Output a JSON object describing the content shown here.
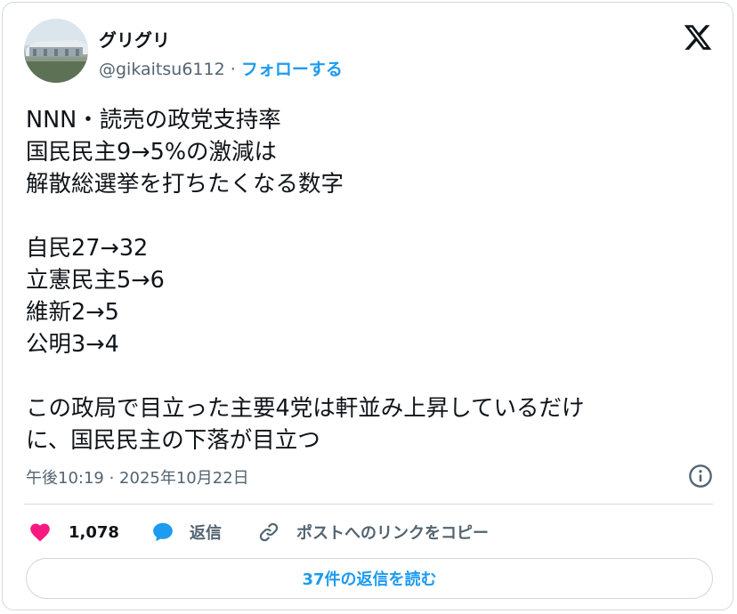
{
  "author": {
    "display_name": "グリグリ",
    "handle": "@gikaitsu6112",
    "separator": " · ",
    "follow_label": "フォローする"
  },
  "icons": {
    "logo": "x-logo-icon",
    "info": "info-icon",
    "like": "heart-icon",
    "reply": "speech-bubble-icon",
    "copy_link": "link-icon"
  },
  "colors": {
    "like": "#f91880",
    "reply": "#1d9bf0",
    "link": "#1d9bf0",
    "text": "#0f1419",
    "muted": "#536471",
    "border": "#cfd9de"
  },
  "tweet": {
    "lines": [
      "NNN・読売の政党支持率",
      "国民民主9→5%の激減は",
      "解散総選挙を打ちたくなる数字",
      "",
      "自民27→32",
      "立憲民主5→6",
      "維新2→5",
      "公明3→4",
      "",
      "この政局で目立った主要4党は軒並み上昇しているだけ",
      "に、国民民主の下落が目立つ"
    ],
    "timestamp": "午後10:19 · 2025年10月22日"
  },
  "actions": {
    "like_count": "1,078",
    "reply_label": "返信",
    "copy_link_label": "ポストへのリンクをコピー"
  },
  "read_replies_label": "37件の返信を読む"
}
